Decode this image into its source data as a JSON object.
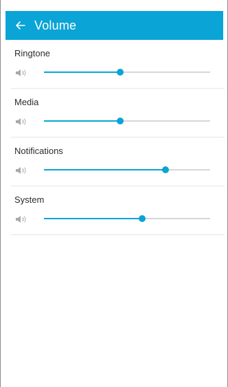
{
  "header": {
    "title": "Volume",
    "background_color": "#0aa4d6",
    "back_icon": "arrow-left-icon"
  },
  "volume_items": [
    {
      "label": "Ringtone",
      "level": 0.46,
      "icon": "speaker-icon"
    },
    {
      "label": "Media",
      "level": 0.46,
      "icon": "speaker-icon"
    },
    {
      "label": "Notifications",
      "level": 0.73,
      "icon": "speaker-icon"
    },
    {
      "label": "System",
      "level": 0.59,
      "icon": "speaker-icon"
    }
  ]
}
